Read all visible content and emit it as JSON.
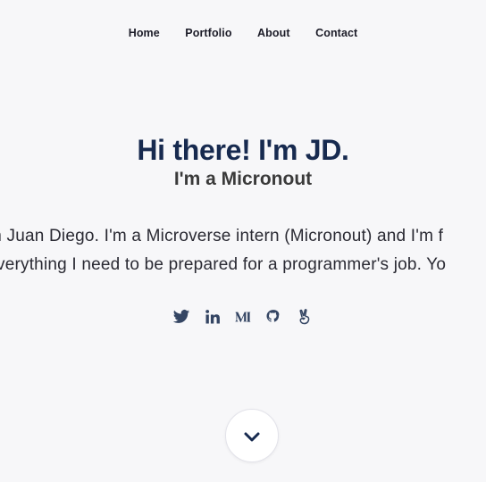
{
  "nav": {
    "items": [
      {
        "label": "Home"
      },
      {
        "label": "Portfolio"
      },
      {
        "label": "About"
      },
      {
        "label": "Contact"
      }
    ]
  },
  "hero": {
    "title": "Hi there! I'm JD.",
    "subtitle": "I'm a Micronout",
    "bio_line1": "m Juan Diego. I'm a Microverse intern (Micronout) and I'm f",
    "bio_line2": "verything I need to be prepared for a programmer's job. Yo"
  },
  "socials": [
    {
      "icon": "twitter-icon"
    },
    {
      "icon": "linkedin-icon"
    },
    {
      "icon": "medium-icon"
    },
    {
      "icon": "github-icon"
    },
    {
      "icon": "angellist-icon"
    }
  ],
  "scroll": {
    "icon": "chevron-down-icon"
  },
  "colors": {
    "background": "#f7f7f9",
    "title": "#172a4f",
    "icon": "#344563",
    "text": "#2a2a33"
  }
}
